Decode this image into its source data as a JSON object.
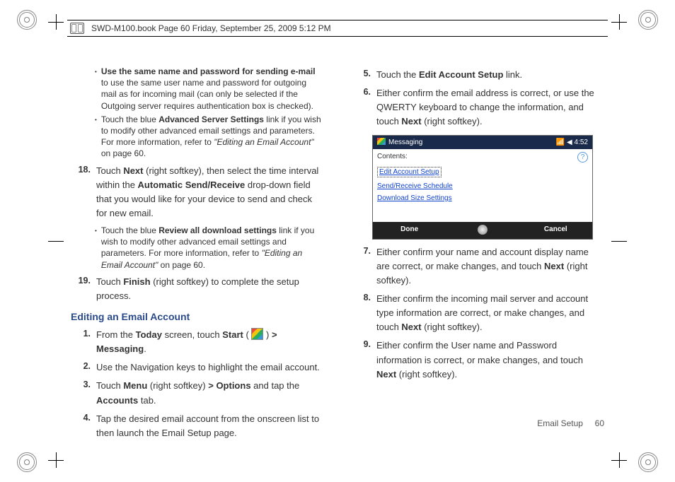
{
  "header": {
    "text": "SWD-M100.book  Page 60  Friday, September 25, 2009  5:12 PM"
  },
  "left": {
    "b1_bold": "Use the same name and password for sending e-mail",
    "b1_rest": " to use the same user name and password for outgoing mail as for incoming mail (can only be selected if the Outgoing server requires authentication box is checked).",
    "b2_a": "Touch the blue ",
    "b2_bold": "Advanced Server Settings",
    "b2_b": " link if you wish to modify other advanced email settings and parameters. For more information, refer to ",
    "b2_it": "\"Editing an Email Account\"",
    "b2_c": "  on page 60.",
    "s18n": "18.",
    "s18_a": "Touch ",
    "s18_b1": "Next",
    "s18_b": " (right softkey), then select the time interval within the ",
    "s18_b2": "Automatic Send/Receive",
    "s18_c": " drop-down field that you would like for your device to send and check for new email.",
    "b3_a": "Touch the blue ",
    "b3_bold": "Review all download settings",
    "b3_b": " link if you wish to modify other advanced email settings and parameters. For more information, refer to ",
    "b3_it": "\"Editing an Email Account\"",
    "b3_c": "  on page 60.",
    "s19n": "19.",
    "s19_a": "Touch ",
    "s19_b1": "Finish",
    "s19_b": " (right softkey) to complete the setup process.",
    "h2": "Editing an Email Account",
    "e1n": "1.",
    "e1_a": "From the ",
    "e1_b1": "Today",
    "e1_b": " screen, touch ",
    "e1_b2": "Start",
    "e1_c": " ( ",
    "e1_d": " ) ",
    "e1_b3": "> Messaging",
    "e1_e": ".",
    "e2n": "2.",
    "e2": "Use the Navigation keys to highlight the email account.",
    "e3n": "3.",
    "e3_a": "Touch ",
    "e3_b1": "Menu",
    "e3_b": " (right softkey) ",
    "e3_b2": "> Options",
    "e3_c": " and tap the ",
    "e3_b3": "Accounts",
    "e3_d": " tab.",
    "e4n": "4.",
    "e4": "Tap the desired email account from the onscreen list to then launch the Email Setup page."
  },
  "right": {
    "s5n": "5.",
    "s5_a": "Touch the ",
    "s5_b1": "Edit Account Setup",
    "s5_b": " link.",
    "s6n": "6.",
    "s6_a": "Either confirm the email address is correct, or use the QWERTY keyboard to change the information, and touch ",
    "s6_b1": "Next",
    "s6_b": " (right softkey).",
    "s7n": "7.",
    "s7_a": "Either confirm your name and account display name are correct, or make changes, and touch ",
    "s7_b1": "Next",
    "s7_b": " (right softkey).",
    "s8n": "8.",
    "s8_a": "Either confirm the incoming mail server and account type information are correct, or make changes, and touch ",
    "s8_b1": "Next",
    "s8_b": " (right softkey).",
    "s9n": "9.",
    "s9_a": "Either confirm the User name and Password information is correct, or make changes, and touch ",
    "s9_b1": "Next",
    "s9_b": " (right softkey)."
  },
  "shot": {
    "title": "Messaging",
    "time": "4:52",
    "contents": "Contents:",
    "l1": "Edit Account Setup",
    "l2": "Send/Receive Schedule",
    "l3": "Download Size Settings",
    "done": "Done",
    "cancel": "Cancel"
  },
  "footer": {
    "label": "Email Setup",
    "page": "60"
  }
}
